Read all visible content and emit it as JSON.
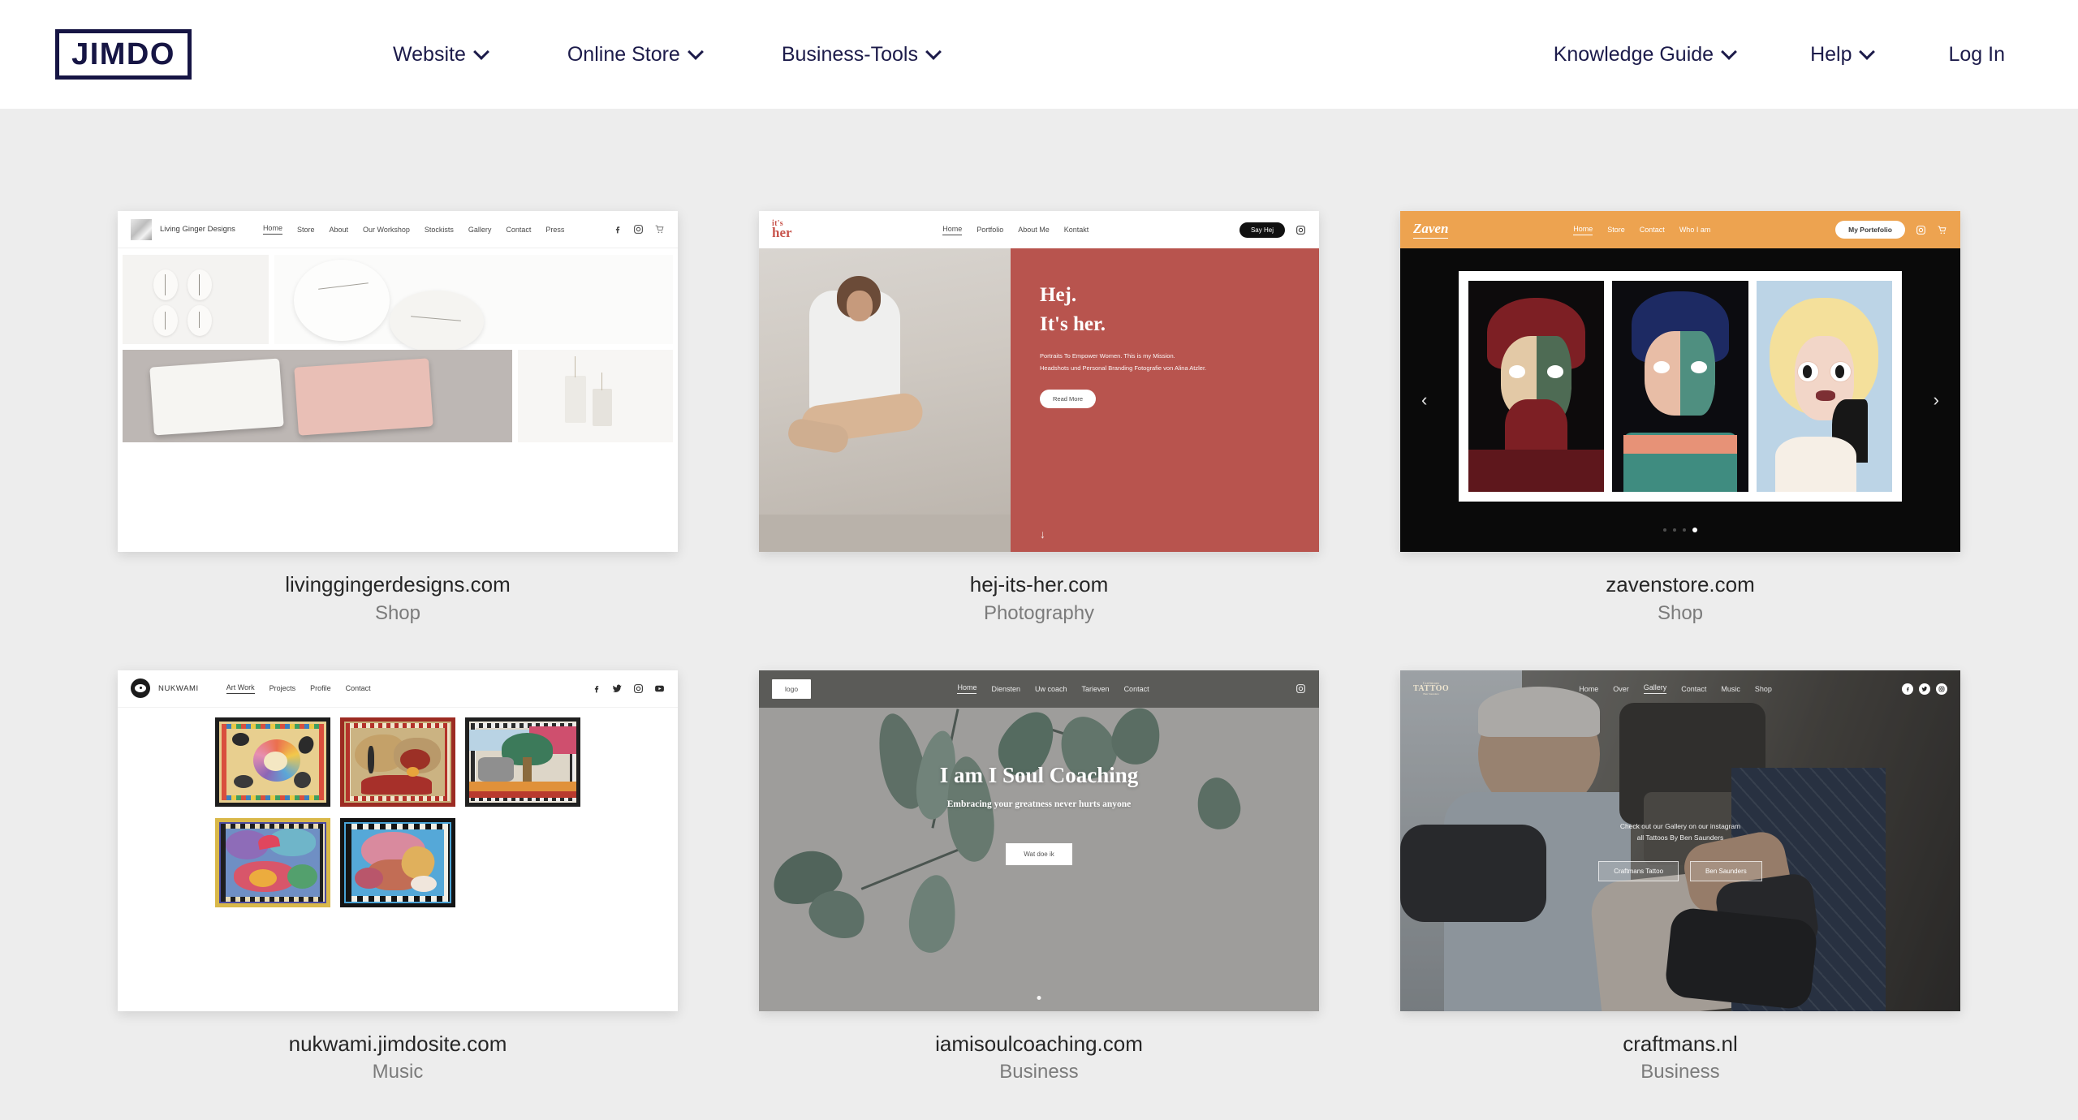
{
  "header": {
    "logo_text": "JIMDO",
    "nav_left": [
      {
        "label": "Website",
        "has_dropdown": true
      },
      {
        "label": "Online Store",
        "has_dropdown": true
      },
      {
        "label": "Business-Tools",
        "has_dropdown": true
      }
    ],
    "nav_right": [
      {
        "label": "Knowledge Guide",
        "has_dropdown": true
      },
      {
        "label": "Help",
        "has_dropdown": true
      },
      {
        "label": "Log In",
        "has_dropdown": false
      }
    ]
  },
  "cards": [
    {
      "domain": "livinggingerdesigns.com",
      "category": "Shop",
      "site": {
        "brand": "Living Ginger Designs",
        "nav": [
          "Home",
          "Store",
          "About",
          "Our Workshop",
          "Stockists",
          "Gallery",
          "Contact",
          "Press"
        ],
        "active_nav": "Home",
        "icons": [
          "facebook-icon",
          "instagram-icon",
          "cart-icon"
        ]
      }
    },
    {
      "domain": "hej-its-her.com",
      "category": "Photography",
      "site": {
        "logo_line1": "it's",
        "logo_line2": "her",
        "nav": [
          "Home",
          "Portfolio",
          "About Me",
          "Kontakt"
        ],
        "active_nav": "Home",
        "cta": "Say Hej",
        "icons": [
          "instagram-icon"
        ],
        "headline_line1": "Hej.",
        "headline_line2": "It's her.",
        "paragraph_line1": "Portraits To Empower Women. This is my Mission.",
        "paragraph_line2": "Headshots und Personal Branding Fotografie von Alina Atzler.",
        "button": "Read More",
        "scroll_hint": "↓"
      }
    },
    {
      "domain": "zavenstore.com",
      "category": "Shop",
      "site": {
        "brand": "Zaven",
        "nav": [
          "Home",
          "Store",
          "Contact",
          "Who I am"
        ],
        "active_nav": "Home",
        "cta": "My Portefolio",
        "icons": [
          "instagram-icon",
          "cart-icon"
        ],
        "carousel": {
          "prev": "‹",
          "next": "›",
          "slides": 4,
          "active_slide": 4
        }
      }
    },
    {
      "domain": "nukwami.jimdosite.com",
      "category": "Music",
      "site": {
        "brand": "NUKWAMI",
        "nav": [
          "Art Work",
          "Projects",
          "Profile",
          "Contact"
        ],
        "active_nav": "Art Work",
        "icons": [
          "facebook-icon",
          "twitter-icon",
          "instagram-icon",
          "youtube-icon"
        ]
      }
    },
    {
      "domain": "iamisoulcoaching.com",
      "category": "Business",
      "site": {
        "brand": "logo",
        "nav": [
          "Home",
          "Diensten",
          "Uw coach",
          "Tarieven",
          "Contact"
        ],
        "active_nav": "Home",
        "icons": [
          "instagram-icon"
        ],
        "headline": "I am I Soul Coaching",
        "subline": "Embracing your greatness never hurts anyone",
        "button": "Wat doe ik"
      }
    },
    {
      "domain": "craftmans.nl",
      "category": "Business",
      "site": {
        "logo_top": "Craftmans",
        "logo_mid": "TATTOO",
        "logo_bot": "Ben Saunders",
        "nav": [
          "Home",
          "Over",
          "Gallery",
          "Contact",
          "Music",
          "Shop"
        ],
        "active_nav": "Gallery",
        "icons": [
          "facebook-icon",
          "twitter-icon",
          "instagram-icon"
        ],
        "overlay_line1": "Check out our Gallery on our instagram",
        "overlay_line2": "all Tattoos By Ben Saunders",
        "button_1": "Craftmans Tattoo",
        "button_2": "Ben Saunders"
      }
    }
  ],
  "colors": {
    "brand_navy": "#161544",
    "page_background": "#ededed",
    "header_background": "#ffffff",
    "caption_text": "#262626",
    "category_text": "#7b7b7b",
    "hej_red": "#b8544e",
    "zaven_orange": "#eda350"
  }
}
